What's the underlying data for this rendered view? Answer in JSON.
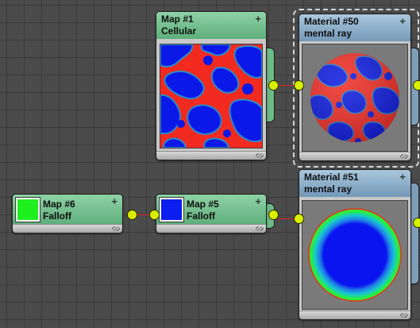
{
  "colors": {
    "green_header": "#6fbf8b",
    "blue_header": "#87a9c4",
    "socket": "#d8f000",
    "wire": "#e02020",
    "selection_dash": "#d6d6d6"
  },
  "nodes": [
    {
      "id": "map1",
      "title": "Map #1",
      "subtitle": "Cellular",
      "plus": "+"
    },
    {
      "id": "mat50",
      "title": "Material #50",
      "subtitle": "mental ray",
      "plus": "+"
    },
    {
      "id": "map6",
      "title": "Map #6",
      "subtitle": "Falloff",
      "plus": "+"
    },
    {
      "id": "map5",
      "title": "Map #5",
      "subtitle": "Falloff",
      "plus": "+"
    },
    {
      "id": "mat51",
      "title": "Material #51",
      "subtitle": "mental ray",
      "plus": "+"
    }
  ]
}
